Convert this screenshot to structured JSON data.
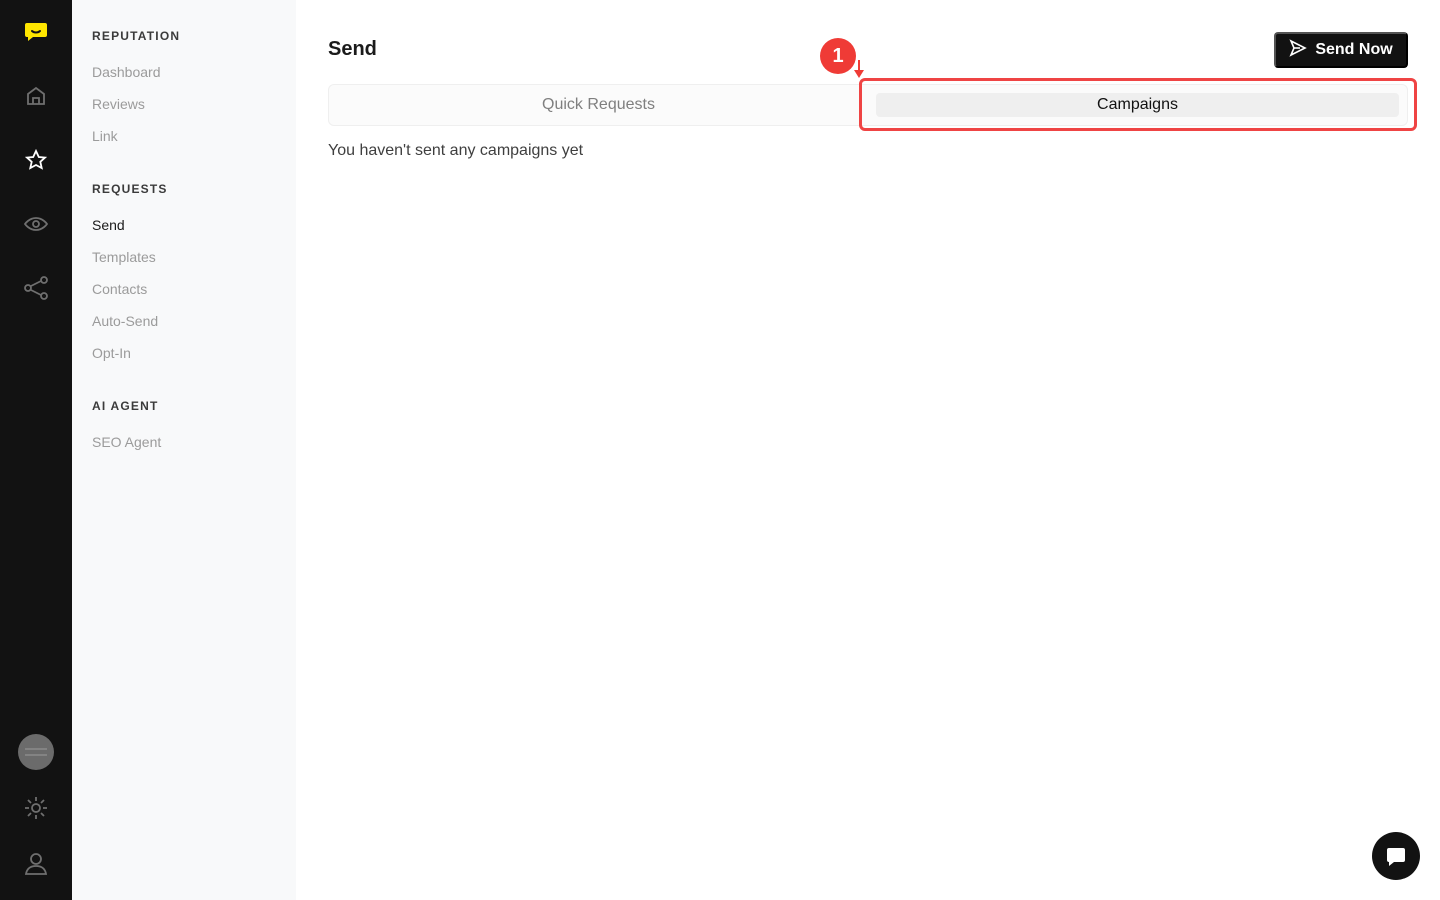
{
  "rail": {
    "icons": [
      "chat-logo-icon",
      "home-icon",
      "star-icon",
      "eye-icon",
      "share-icon",
      "avatar",
      "gear-icon",
      "user-icon"
    ]
  },
  "sidebar": {
    "sections": [
      {
        "title": "REPUTATION",
        "items": [
          {
            "label": "Dashboard",
            "active": false
          },
          {
            "label": "Reviews",
            "active": false
          },
          {
            "label": "Link",
            "active": false
          }
        ]
      },
      {
        "title": "REQUESTS",
        "items": [
          {
            "label": "Send",
            "active": true
          },
          {
            "label": "Templates",
            "active": false
          },
          {
            "label": "Contacts",
            "active": false
          },
          {
            "label": "Auto-Send",
            "active": false
          },
          {
            "label": "Opt-In",
            "active": false
          }
        ]
      },
      {
        "title": "AI AGENT",
        "items": [
          {
            "label": "SEO Agent",
            "active": false
          }
        ]
      }
    ]
  },
  "header": {
    "title": "Send",
    "send_now_label": "Send Now"
  },
  "tabs": {
    "quick_requests": "Quick Requests",
    "campaigns": "Campaigns",
    "selected": "Campaigns"
  },
  "content": {
    "empty_message": "You haven't sent any campaigns yet"
  },
  "annotation": {
    "badge": "1"
  },
  "colors": {
    "rail_bg": "#121212",
    "accent_logo": "#ffe600",
    "highlight": "#ef4444"
  }
}
